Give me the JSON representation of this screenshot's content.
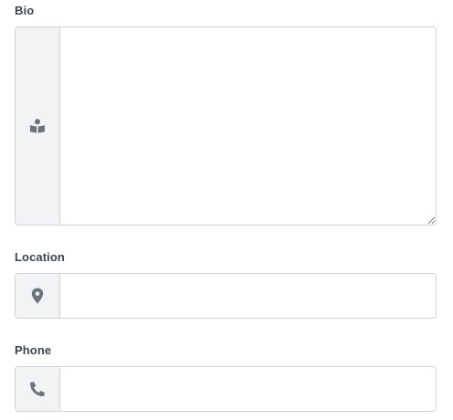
{
  "form": {
    "bio": {
      "label": "Bio",
      "value": "",
      "icon": "book-reader-icon"
    },
    "location": {
      "label": "Location",
      "value": "",
      "icon": "map-marker-icon"
    },
    "phone": {
      "label": "Phone",
      "value": "",
      "icon": "phone-icon"
    }
  },
  "colors": {
    "border": "#cfd3d7",
    "addon_bg": "#f2f3f5",
    "icon": "#6b747d",
    "label": "#3a4650"
  }
}
